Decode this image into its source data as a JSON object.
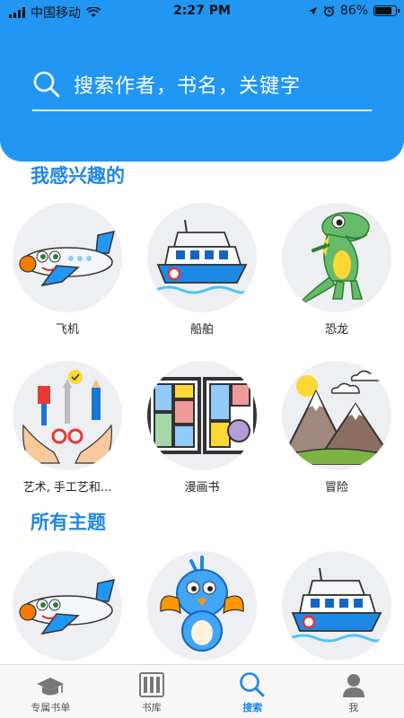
{
  "status": {
    "carrier": "中国移动",
    "time": "2:27 PM",
    "battery": "86%",
    "battery_level": 0.86
  },
  "search": {
    "placeholder": "搜索作者，书名，关键字"
  },
  "interests": {
    "title": "我感兴趣的",
    "items": [
      {
        "label": "飞机",
        "icon": "airplane-icon"
      },
      {
        "label": "船舶",
        "icon": "ship-icon"
      },
      {
        "label": "恐龙",
        "icon": "dinosaur-icon"
      },
      {
        "label": "艺术, 手工艺和...",
        "icon": "crafts-icon"
      },
      {
        "label": "漫画书",
        "icon": "comic-book-icon"
      },
      {
        "label": "冒险",
        "icon": "mountain-icon"
      }
    ]
  },
  "all_topics": {
    "title": "所有主题",
    "items": [
      {
        "icon": "airplane-icon"
      },
      {
        "icon": "bird-icon"
      },
      {
        "icon": "ship-icon"
      }
    ]
  },
  "tabbar": {
    "tabs": [
      {
        "label": "专属书单",
        "icon": "graduation-cap-icon"
      },
      {
        "label": "书库",
        "icon": "library-icon"
      },
      {
        "label": "搜索",
        "icon": "search-icon",
        "active": true
      },
      {
        "label": "我",
        "icon": "person-icon"
      }
    ]
  },
  "colors": {
    "header": "#2196f3",
    "accent": "#1e88e5"
  }
}
